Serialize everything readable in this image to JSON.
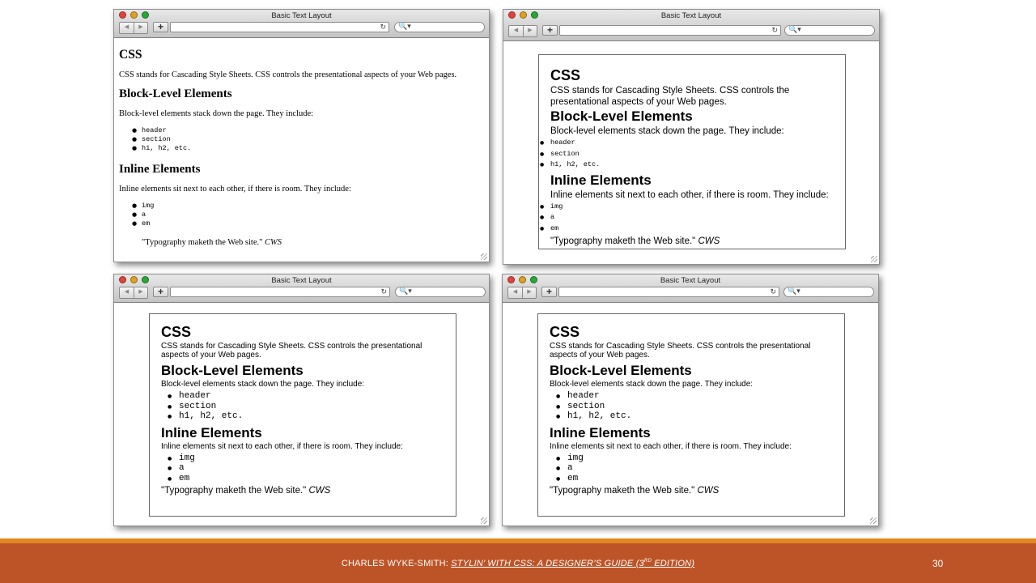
{
  "browser": {
    "window_title": "Basic Text Layout",
    "back_glyph": "◀",
    "forward_glyph": "▶",
    "add_glyph": "+",
    "reload_glyph": "↻",
    "search_glyph": "🔍▾"
  },
  "doc": {
    "h1": "CSS",
    "intro": "CSS stands for Cascading Style Sheets. CSS controls the presentational aspects of your Web pages.",
    "h2_block": "Block-Level Elements",
    "block_text": "Block-level elements stack down the page. They include:",
    "block_items": [
      "header",
      "section",
      "h1, h2, etc."
    ],
    "h2_inline": "Inline Elements",
    "inline_text": "Inline elements sit next to each other, if there is room. They include:",
    "inline_items": [
      "img",
      "a",
      "em"
    ],
    "quote": "\"Typography maketh the Web site.\"",
    "quote_author": "CWS"
  },
  "footer": {
    "author": "CHARLES WYKE-SMITH: ",
    "book_title": "STYLIN’ WITH CSS: A DESIGNER’S GUIDE",
    "edition_open": " (3",
    "edition_sup": "RD",
    "edition_close": " EDITION)",
    "page_number": "30",
    "accent_color": "#e1871f",
    "bar_color": "#bd5427"
  }
}
